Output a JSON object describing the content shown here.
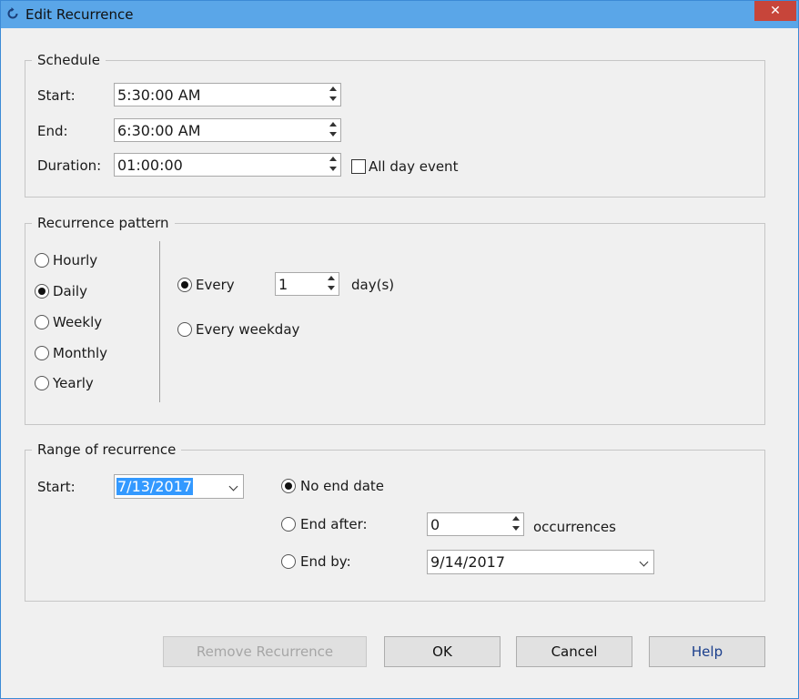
{
  "window": {
    "title": "Edit Recurrence",
    "close_label": "✕"
  },
  "schedule": {
    "legend": "Schedule",
    "start_label": "Start:",
    "start_value": "5:30:00 AM",
    "end_label": "End:",
    "end_value": "6:30:00 AM",
    "duration_label": "Duration:",
    "duration_value": "01:00:00",
    "all_day_label": "All day event",
    "all_day_checked": false
  },
  "pattern": {
    "legend": "Recurrence pattern",
    "frequencies": [
      "Hourly",
      "Daily",
      "Weekly",
      "Monthly",
      "Yearly"
    ],
    "selected_frequency": "Daily",
    "every_label": "Every",
    "every_value": "1",
    "unit_label": "day(s)",
    "every_weekday_label": "Every weekday",
    "selected_option": "Every"
  },
  "range": {
    "legend": "Range of recurrence",
    "start_label": "Start:",
    "start_value": "7/13/2017",
    "no_end_label": "No end date",
    "end_after_label": "End after:",
    "end_after_value": "0",
    "occurrences_label": "occurrences",
    "end_by_label": "End by:",
    "end_by_value": "9/14/2017",
    "selected_option": "No end date"
  },
  "buttons": {
    "remove": "Remove Recurrence",
    "ok": "OK",
    "cancel": "Cancel",
    "help": "Help"
  }
}
